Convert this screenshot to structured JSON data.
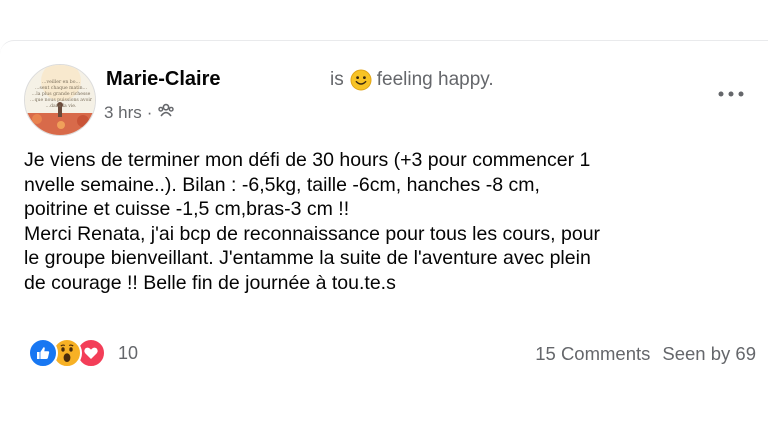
{
  "post": {
    "author": "Marie-Claire",
    "feeling_prefix": "is",
    "feeling_text": "feeling happy.",
    "time": "3 hrs",
    "audience_icon": "group-icon",
    "avatar_text": [
      "…veiller en bo…",
      "…sent chaque matin…",
      "…la plus grande richesse",
      "…que nous puissions avoir",
      "…dans la vie."
    ],
    "lines": [
      "Je viens de terminer mon défi de 30 hours (+3 pour commencer 1",
      "nvelle semaine..). Bilan  : -6,5kg, taille -6cm, hanches -8 cm,",
      "poitrine et cuisse -1,5 cm,bras-3 cm !!",
      "Merci Renata, j'ai bcp de reconnaissance pour tous les cours, pour",
      "le groupe bienveillant. J'entamme la suite de l'aventure avec plein",
      "de courage !! Belle fin de journée à tou.te.s"
    ]
  },
  "footer": {
    "reaction_icons": [
      "like-icon",
      "wow-icon",
      "love-icon"
    ],
    "reaction_count": "10",
    "comments": "15 Comments",
    "seen_by": "Seen by 69"
  },
  "colors": {
    "like": "#1877f2",
    "wow": "#f7b125",
    "love": "#f33e58",
    "secondary_text": "#65676b"
  }
}
